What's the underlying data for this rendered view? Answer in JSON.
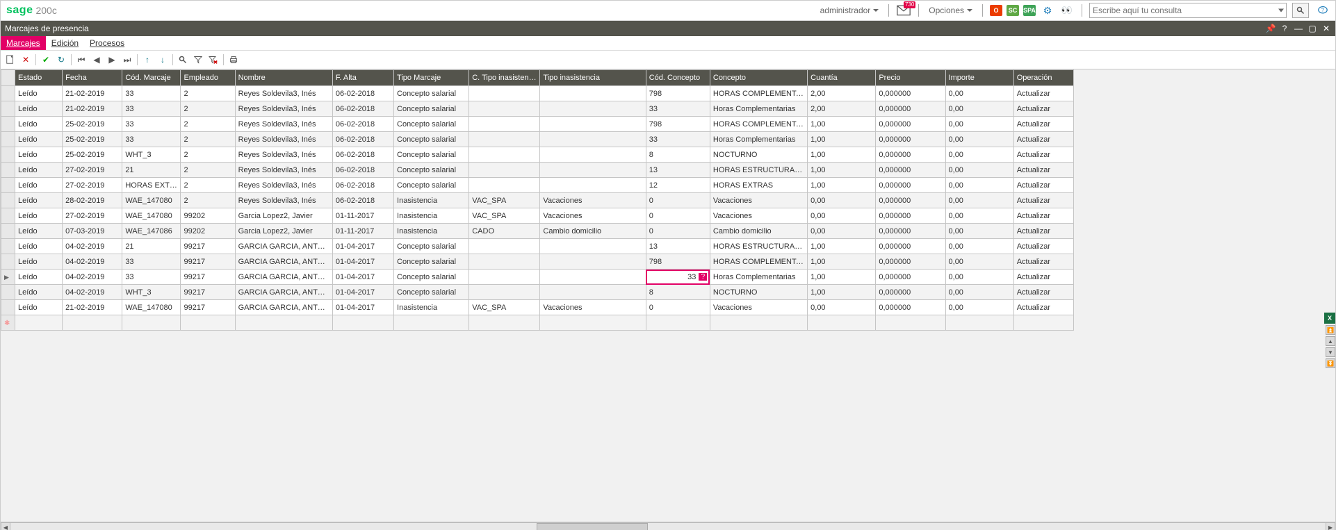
{
  "app": {
    "logo": "sage",
    "sub": "200c"
  },
  "top": {
    "user": "administrador",
    "options": "Opciones",
    "mail_badge": "730",
    "chip1": "O",
    "chip2": "SC",
    "chip3": "SPA",
    "search_placeholder": "Escribe aquí tu consulta"
  },
  "window": {
    "title": "Marcajes de presencia"
  },
  "menu": {
    "marcajes": "Marcajes",
    "edicion": "Edición",
    "procesos": "Procesos"
  },
  "columns": {
    "estado": "Estado",
    "fecha": "Fecha",
    "cod_marcaje": "Cód. Marcaje",
    "empleado": "Empleado",
    "nombre": "Nombre",
    "f_alta": "F. Alta",
    "tipo_marcaje": "Tipo Marcaje",
    "c_tipo_inas": "C. Tipo inasistencia",
    "tipo_inas": "Tipo inasistencia",
    "cod_concepto": "Cód. Concepto",
    "concepto": "Concepto",
    "cuantia": "Cuantía",
    "precio": "Precio",
    "importe": "Importe",
    "operacion": "Operación"
  },
  "rows": [
    {
      "estado": "Leído",
      "fecha": "21-02-2019",
      "cod_marcaje": "33",
      "empleado": "2",
      "nombre": "Reyes Soldevila3, Inés",
      "f_alta": "06-02-2018",
      "tipo_marcaje": "Concepto salarial",
      "c_tipo_inas": "",
      "tipo_inas": "",
      "cod_concepto": "798",
      "concepto": "HORAS COMPLEMENTARIAS",
      "cuantia": "2,00",
      "precio": "0,000000",
      "importe": "0,00",
      "operacion": "Actualizar"
    },
    {
      "estado": "Leído",
      "fecha": "21-02-2019",
      "cod_marcaje": "33",
      "empleado": "2",
      "nombre": "Reyes Soldevila3, Inés",
      "f_alta": "06-02-2018",
      "tipo_marcaje": "Concepto salarial",
      "c_tipo_inas": "",
      "tipo_inas": "",
      "cod_concepto": "33",
      "concepto": "Horas Complementarias",
      "cuantia": "2,00",
      "precio": "0,000000",
      "importe": "0,00",
      "operacion": "Actualizar"
    },
    {
      "estado": "Leído",
      "fecha": "25-02-2019",
      "cod_marcaje": "33",
      "empleado": "2",
      "nombre": "Reyes Soldevila3, Inés",
      "f_alta": "06-02-2018",
      "tipo_marcaje": "Concepto salarial",
      "c_tipo_inas": "",
      "tipo_inas": "",
      "cod_concepto": "798",
      "concepto": "HORAS COMPLEMENTARIAS",
      "cuantia": "1,00",
      "precio": "0,000000",
      "importe": "0,00",
      "operacion": "Actualizar"
    },
    {
      "estado": "Leído",
      "fecha": "25-02-2019",
      "cod_marcaje": "33",
      "empleado": "2",
      "nombre": "Reyes Soldevila3, Inés",
      "f_alta": "06-02-2018",
      "tipo_marcaje": "Concepto salarial",
      "c_tipo_inas": "",
      "tipo_inas": "",
      "cod_concepto": "33",
      "concepto": "Horas Complementarias",
      "cuantia": "1,00",
      "precio": "0,000000",
      "importe": "0,00",
      "operacion": "Actualizar"
    },
    {
      "estado": "Leído",
      "fecha": "25-02-2019",
      "cod_marcaje": "WHT_3",
      "empleado": "2",
      "nombre": "Reyes Soldevila3, Inés",
      "f_alta": "06-02-2018",
      "tipo_marcaje": "Concepto salarial",
      "c_tipo_inas": "",
      "tipo_inas": "",
      "cod_concepto": "8",
      "concepto": "NOCTURNO",
      "cuantia": "1,00",
      "precio": "0,000000",
      "importe": "0,00",
      "operacion": "Actualizar"
    },
    {
      "estado": "Leído",
      "fecha": "27-02-2019",
      "cod_marcaje": "21",
      "empleado": "2",
      "nombre": "Reyes Soldevila3, Inés",
      "f_alta": "06-02-2018",
      "tipo_marcaje": "Concepto salarial",
      "c_tipo_inas": "",
      "tipo_inas": "",
      "cod_concepto": "13",
      "concepto": "HORAS ESTRUCTURALES",
      "cuantia": "1,00",
      "precio": "0,000000",
      "importe": "0,00",
      "operacion": "Actualizar"
    },
    {
      "estado": "Leído",
      "fecha": "27-02-2019",
      "cod_marcaje": "HORAS EXTRAS",
      "empleado": "2",
      "nombre": "Reyes Soldevila3, Inés",
      "f_alta": "06-02-2018",
      "tipo_marcaje": "Concepto salarial",
      "c_tipo_inas": "",
      "tipo_inas": "",
      "cod_concepto": "12",
      "concepto": "HORAS EXTRAS",
      "cuantia": "1,00",
      "precio": "0,000000",
      "importe": "0,00",
      "operacion": "Actualizar"
    },
    {
      "estado": "Leído",
      "fecha": "28-02-2019",
      "cod_marcaje": "WAE_147080",
      "empleado": "2",
      "nombre": "Reyes Soldevila3, Inés",
      "f_alta": "06-02-2018",
      "tipo_marcaje": "Inasistencia",
      "c_tipo_inas": "VAC_SPA",
      "tipo_inas": "Vacaciones",
      "cod_concepto": "0",
      "concepto": "Vacaciones",
      "cuantia": "0,00",
      "precio": "0,000000",
      "importe": "0,00",
      "operacion": "Actualizar"
    },
    {
      "estado": "Leído",
      "fecha": "27-02-2019",
      "cod_marcaje": "WAE_147080",
      "empleado": "99202",
      "nombre": "Garcia Lopez2, Javier",
      "f_alta": "01-11-2017",
      "tipo_marcaje": "Inasistencia",
      "c_tipo_inas": "VAC_SPA",
      "tipo_inas": "Vacaciones",
      "cod_concepto": "0",
      "concepto": "Vacaciones",
      "cuantia": "0,00",
      "precio": "0,000000",
      "importe": "0,00",
      "operacion": "Actualizar"
    },
    {
      "estado": "Leído",
      "fecha": "07-03-2019",
      "cod_marcaje": "WAE_147086",
      "empleado": "99202",
      "nombre": "Garcia Lopez2, Javier",
      "f_alta": "01-11-2017",
      "tipo_marcaje": "Inasistencia",
      "c_tipo_inas": "CADO",
      "tipo_inas": "Cambio domicilio",
      "cod_concepto": "0",
      "concepto": "Cambio domicilio",
      "cuantia": "0,00",
      "precio": "0,000000",
      "importe": "0,00",
      "operacion": "Actualizar"
    },
    {
      "estado": "Leído",
      "fecha": "04-02-2019",
      "cod_marcaje": "21",
      "empleado": "99217",
      "nombre": "GARCIA GARCIA, ANTONIO",
      "f_alta": "01-04-2017",
      "tipo_marcaje": "Concepto salarial",
      "c_tipo_inas": "",
      "tipo_inas": "",
      "cod_concepto": "13",
      "concepto": "HORAS ESTRUCTURALES",
      "cuantia": "1,00",
      "precio": "0,000000",
      "importe": "0,00",
      "operacion": "Actualizar"
    },
    {
      "estado": "Leído",
      "fecha": "04-02-2019",
      "cod_marcaje": "33",
      "empleado": "99217",
      "nombre": "GARCIA GARCIA, ANTONIO",
      "f_alta": "01-04-2017",
      "tipo_marcaje": "Concepto salarial",
      "c_tipo_inas": "",
      "tipo_inas": "",
      "cod_concepto": "798",
      "concepto": "HORAS COMPLEMENTARIAS",
      "cuantia": "1,00",
      "precio": "0,000000",
      "importe": "0,00",
      "operacion": "Actualizar"
    },
    {
      "estado": "Leído",
      "fecha": "04-02-2019",
      "cod_marcaje": "33",
      "empleado": "99217",
      "nombre": "GARCIA GARCIA, ANTONIO",
      "f_alta": "01-04-2017",
      "tipo_marcaje": "Concepto salarial",
      "c_tipo_inas": "",
      "tipo_inas": "",
      "cod_concepto": "33",
      "concepto": "Horas Complementarias",
      "cuantia": "1,00",
      "precio": "0,000000",
      "importe": "0,00",
      "operacion": "Actualizar"
    },
    {
      "estado": "Leído",
      "fecha": "04-02-2019",
      "cod_marcaje": "WHT_3",
      "empleado": "99217",
      "nombre": "GARCIA GARCIA, ANTONIO",
      "f_alta": "01-04-2017",
      "tipo_marcaje": "Concepto salarial",
      "c_tipo_inas": "",
      "tipo_inas": "",
      "cod_concepto": "8",
      "concepto": "NOCTURNO",
      "cuantia": "1,00",
      "precio": "0,000000",
      "importe": "0,00",
      "operacion": "Actualizar"
    },
    {
      "estado": "Leído",
      "fecha": "21-02-2019",
      "cod_marcaje": "WAE_147080",
      "empleado": "99217",
      "nombre": "GARCIA GARCIA, ANTONIO",
      "f_alta": "01-04-2017",
      "tipo_marcaje": "Inasistencia",
      "c_tipo_inas": "VAC_SPA",
      "tipo_inas": "Vacaciones",
      "cod_concepto": "0",
      "concepto": "Vacaciones",
      "cuantia": "0,00",
      "precio": "0,000000",
      "importe": "0,00",
      "operacion": "Actualizar"
    }
  ],
  "selected_row_index": 12,
  "selected_value": "33",
  "excel_chip": "X"
}
